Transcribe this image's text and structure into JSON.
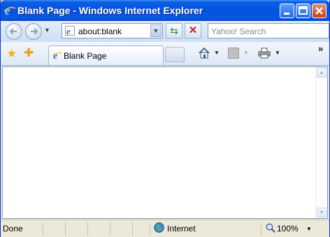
{
  "window": {
    "title": "Blank Page - Windows Internet Explorer"
  },
  "address": {
    "url": "about:blank"
  },
  "search": {
    "placeholder": "Yahoo! Search"
  },
  "tabs": [
    {
      "label": "Blank Page"
    }
  ],
  "status": {
    "text": "Done",
    "zone": "Internet",
    "zoom": "100%"
  },
  "icons": {
    "app": "ie-icon",
    "back": "back-arrow-icon",
    "forward": "forward-arrow-icon",
    "refresh": "refresh-icon",
    "stop": "stop-icon",
    "favorites": "star-icon",
    "add_favorites": "add-favorites-icon",
    "home": "home-icon",
    "feeds": "feeds-icon",
    "print": "printer-icon",
    "zone": "globe-icon",
    "zoom": "magnifier-icon"
  },
  "colors": {
    "titlebar": "#0453dc",
    "close_button": "#c83f12"
  }
}
